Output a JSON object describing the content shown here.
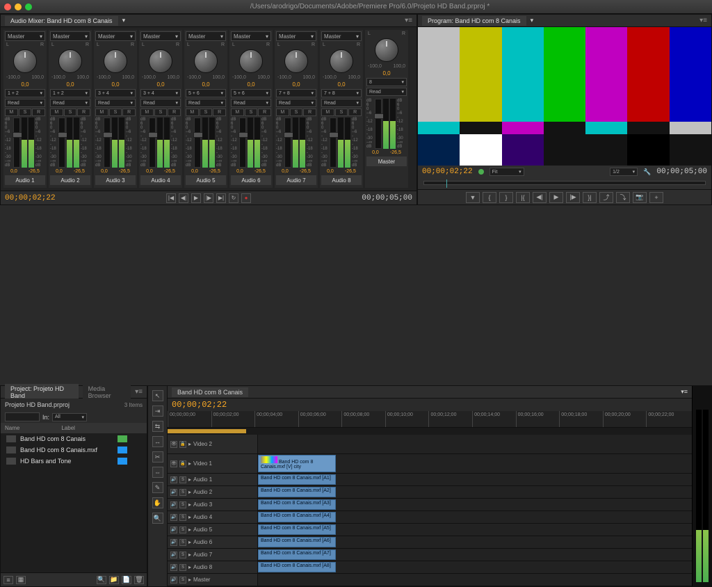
{
  "window": {
    "title": "/Users/arodrigo/Documents/Adobe/Premiere Pro/6.0/Projeto HD Band.prproj *"
  },
  "mixer": {
    "tab": "Audio Mixer: Band HD com 8 Canais",
    "bus_label": "Master",
    "knob_L": "L",
    "knob_R": "R",
    "knob_min": "-100,0",
    "knob_max": "100,0",
    "msr": [
      "M",
      "S",
      "R"
    ],
    "scale": [
      "dB",
      "6",
      "0",
      "--6",
      "--12",
      "--18",
      "--30",
      "--∞",
      "dB"
    ],
    "val_left": "0,0",
    "val_right": "-26,5",
    "sends": [
      {
        "send": "1 + 2",
        "mode": "Read"
      },
      {
        "send": "1 + 2",
        "mode": "Read"
      },
      {
        "send": "3 + 4",
        "mode": "Read"
      },
      {
        "send": "3 + 4",
        "mode": "Read"
      },
      {
        "send": "5 + 6",
        "mode": "Read"
      },
      {
        "send": "5 + 6",
        "mode": "Read"
      },
      {
        "send": "7 + 8",
        "mode": "Read"
      },
      {
        "send": "7 + 8",
        "mode": "Read"
      }
    ],
    "knob_val_main": "0,0",
    "channels": [
      "Audio 1",
      "Audio 2",
      "Audio 3",
      "Audio 4",
      "Audio 5",
      "Audio 6",
      "Audio 7",
      "Audio 8"
    ],
    "master": "Master",
    "master_send": "8",
    "master_mode": "Read",
    "tc": "00;00;02;22",
    "end_tc": "00;00;05;00"
  },
  "program": {
    "tab": "Program: Band HD com 8 Canais",
    "tc": "00;00;02;22",
    "fit": "Fit",
    "zoom": "1/2",
    "dur": "00;00;05;00"
  },
  "project": {
    "tabs": [
      "Project: Projeto HD Band",
      "Media Browser"
    ],
    "name": "Projeto HD Band.prproj",
    "count": "3 Items",
    "search_label": "In:",
    "search_scope": "All",
    "col_name": "Name",
    "col_label": "Label",
    "items": [
      {
        "name": "Band HD com 8 Canais",
        "color": "#4caf50"
      },
      {
        "name": "Band HD com 8 Canais.mxf",
        "color": "#2196f3"
      },
      {
        "name": "HD Bars and Tone",
        "color": "#2196f3"
      }
    ]
  },
  "timeline": {
    "tab": "Band HD com 8 Canais",
    "tc": "00;00;02;22",
    "ruler": [
      "00;00;00;00",
      "00;00;02;00",
      "00;00;04;00",
      "00;00;06;00",
      "00;00;08;00",
      "00;00;10;00",
      "00;00;12;00",
      "00;00;14;00",
      "00;00;16;00",
      "00;00;18;00",
      "00;00;20;00",
      "00;00;22;00"
    ],
    "video_track": "Video 1",
    "video_clip": "Band HD com 8 Canais.mxf [V] city",
    "audio_tracks": [
      "Audio 1",
      "Audio 2",
      "Audio 3",
      "Audio 4",
      "Audio 5",
      "Audio 6",
      "Audio 7",
      "Audio 8"
    ],
    "audio_clips": [
      "Band HD com 8 Canais.mxf [A1]",
      "Band HD com 8 Canais.mxf [A2]",
      "Band HD com 8 Canais.mxf [A3]",
      "Band HD com 8 Canais.mxf [A4]",
      "Band HD com 8 Canais.mxf [A5]",
      "Band HD com 8 Canais.mxf [A6]",
      "Band HD com 8 Canais.mxf [A7]",
      "Band HD com 8 Canais.mxf [A8]"
    ],
    "master_track": "Master"
  }
}
